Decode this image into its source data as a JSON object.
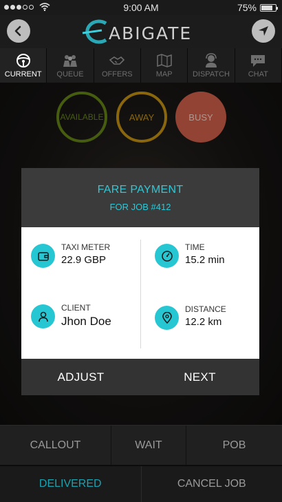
{
  "status_bar": {
    "time": "9:00 AM",
    "battery_text": "75%",
    "battery_level": 0.75,
    "signal_bars_filled": 3,
    "signal_bars_total": 5
  },
  "header": {
    "logo_text": "ABIGATE",
    "back_icon": "chevron-left-icon",
    "navigate_icon": "navigation-arrow-icon"
  },
  "tabs": [
    {
      "label": "CURRENT",
      "icon": "steering-wheel-icon",
      "active": true
    },
    {
      "label": "QUEUE",
      "icon": "people-icon",
      "active": false
    },
    {
      "label": "OFFERS",
      "icon": "handshake-icon",
      "active": false
    },
    {
      "label": "MAP",
      "icon": "map-icon",
      "active": false
    },
    {
      "label": "DISPATCH",
      "icon": "headset-icon",
      "active": false
    },
    {
      "label": "CHAT",
      "icon": "chat-bubble-icon",
      "active": false
    }
  ],
  "availability": {
    "available": "AVAILABLE",
    "away": "AWAY",
    "busy": "BUSY",
    "colors": {
      "available": "#5e7d14",
      "away": "#b98a10",
      "busy": "#c45a44"
    }
  },
  "modal": {
    "title": "FARE PAYMENT",
    "subtitle": "FOR JOB #412",
    "accent_color": "#2ec9d8",
    "taxi_meter": {
      "label": "TAXI METER",
      "value": "22.9 GBP",
      "icon": "wallet-icon"
    },
    "time": {
      "label": "TIME",
      "value": "15.2 min",
      "icon": "speedometer-icon"
    },
    "client": {
      "label": "CLIENT",
      "value": "Jhon Doe",
      "icon": "person-icon"
    },
    "distance": {
      "label": "DISTANCE",
      "value": "12.2 km",
      "icon": "location-pin-icon"
    },
    "adjust_label": "ADJUST",
    "next_label": "NEXT"
  },
  "actions": {
    "callout": "CALLOUT",
    "wait": "WAIT",
    "pob": "POB"
  },
  "bottom": {
    "delivered": "DELIVERED",
    "cancel_job": "CANCEL JOB",
    "delivered_color": "#19a2b0"
  }
}
